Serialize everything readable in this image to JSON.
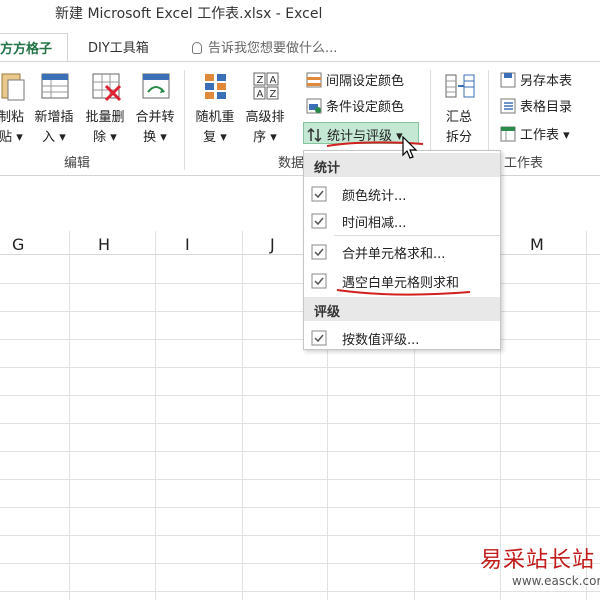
{
  "window": {
    "title": "新建 Microsoft Excel 工作表.xlsx - Excel"
  },
  "tabs": {
    "active": "方方格子",
    "diy": "DIY工具箱",
    "tell_me": "告诉我您想要做什么..."
  },
  "ribbon": {
    "big_buttons": [
      {
        "label": "制粘\n贴 ▾"
      },
      {
        "label": "新增插\n入 ▾"
      },
      {
        "label": "批量删\n除 ▾"
      },
      {
        "label": "合并转\n换 ▾"
      },
      {
        "label": "随机重\n复 ▾"
      },
      {
        "label": "高级排\n序 ▾"
      },
      {
        "label": "汇总\n拆分"
      }
    ],
    "group_labels": {
      "edit": "编辑",
      "data": "数据",
      "workbook": "工作表"
    },
    "small_buttons": {
      "interval_color": "间隔设定颜色",
      "condition_color": "条件设定颜色",
      "stats_rating": "统计与评级 ▾",
      "save_copy": "另存本表",
      "sheet_dir": "表格目录",
      "worksheet": "工作表 ▾"
    }
  },
  "columns": [
    "G",
    "H",
    "I",
    "J",
    "M"
  ],
  "menu": {
    "section_stats": "统计",
    "items_stats": [
      "颜色统计...",
      "时间相减...",
      "合并单元格求和...",
      "遇空白单元格则求和"
    ],
    "section_rating": "评级",
    "items_rating": [
      "按数值评级..."
    ]
  },
  "watermark": {
    "name": "易采站长站",
    "url": "www.easck.com"
  },
  "colors": {
    "excel_green": "#217346",
    "highlight": "#c5e8d4",
    "annotation_red": "#d21f1f"
  }
}
